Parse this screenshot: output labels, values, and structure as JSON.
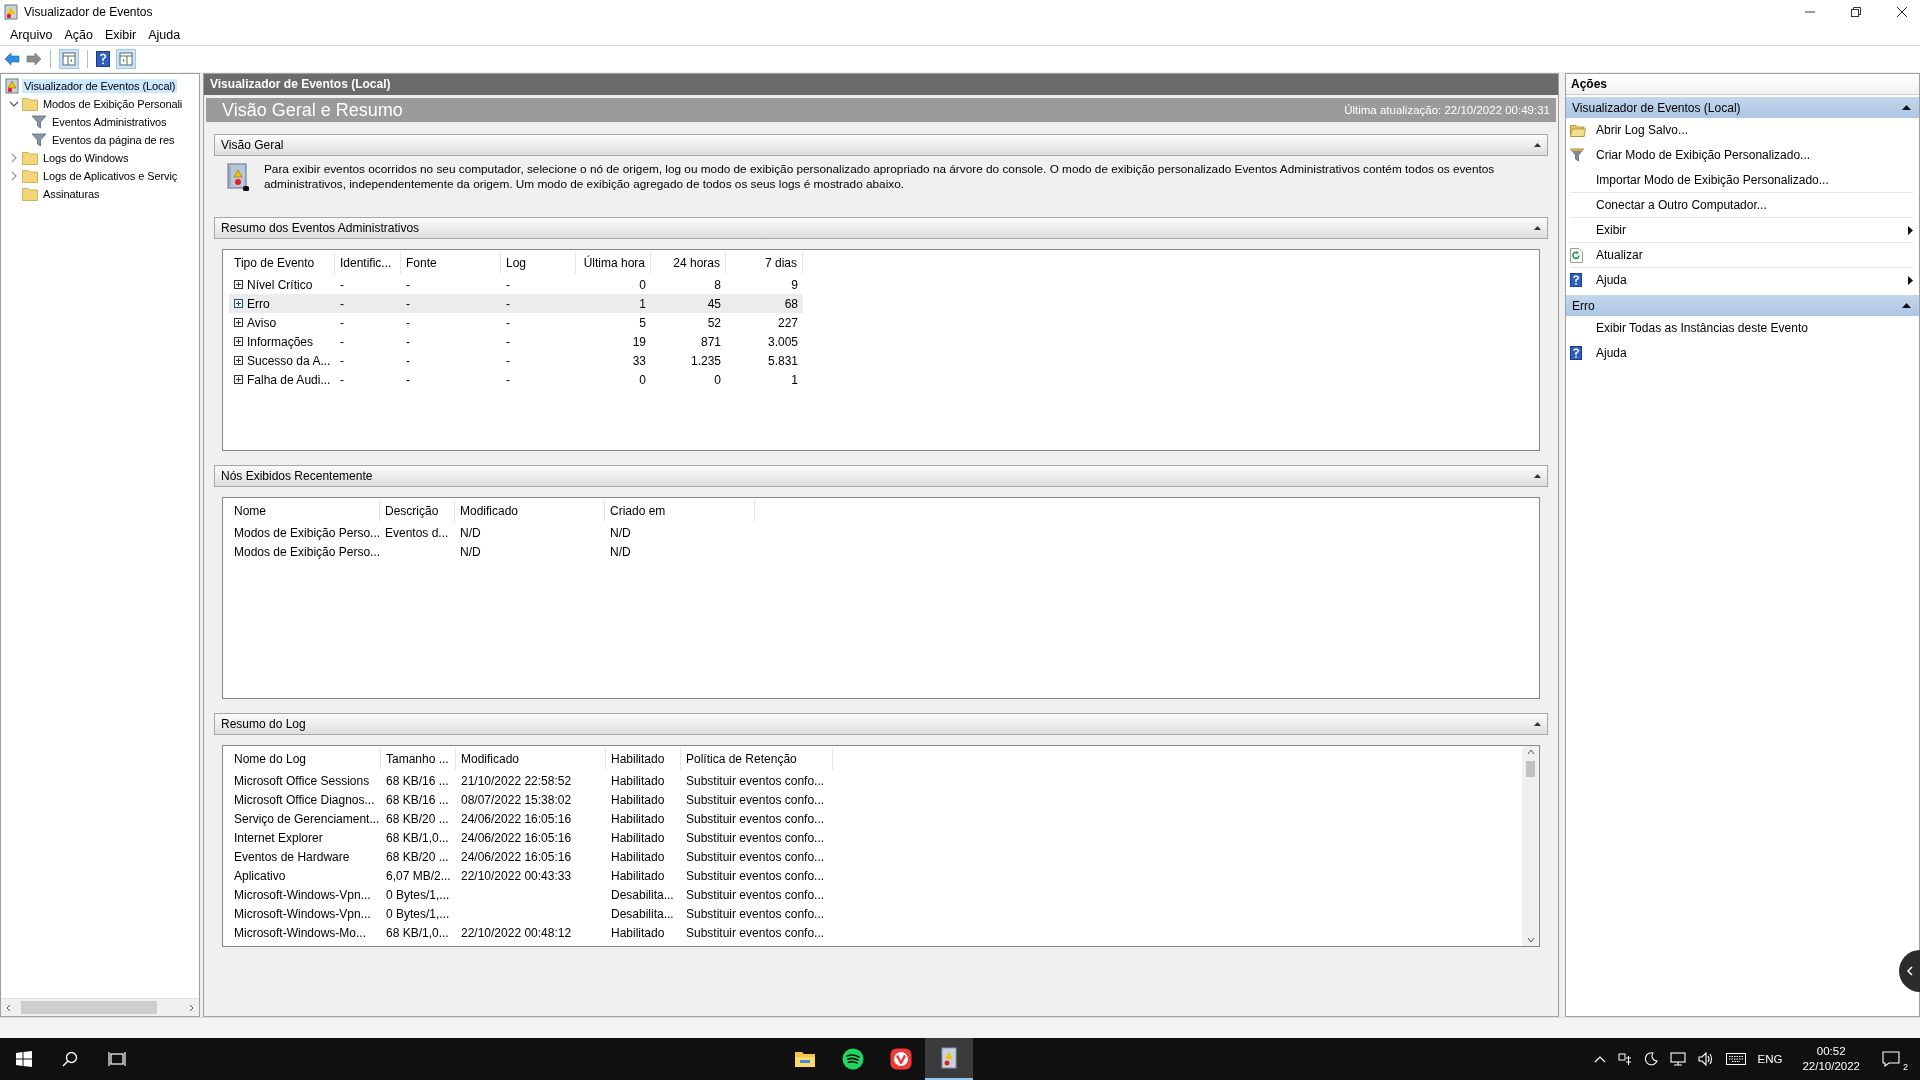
{
  "window": {
    "title": "Visualizador de Eventos"
  },
  "menu": [
    "Arquivo",
    "Ação",
    "Exibir",
    "Ajuda"
  ],
  "tree": [
    {
      "label": "Visualizador de Eventos (Local)",
      "selected": true,
      "children": [
        {
          "label": "Modos de Exibição Personali",
          "selected": false,
          "expanded": true,
          "children": [
            {
              "label": "Eventos Administrativos",
              "selected": false
            },
            {
              "label": "Eventos da página de res",
              "selected": false
            }
          ]
        },
        {
          "label": "Logs do Windows",
          "selected": false,
          "expanded": false
        },
        {
          "label": "Logs de Aplicativos e Serviç",
          "selected": false,
          "expanded": false
        },
        {
          "label": "Assinaturas",
          "selected": false
        }
      ]
    }
  ],
  "center": {
    "title": "Visualizador de Eventos (Local)",
    "heading": "Visão Geral e Resumo",
    "last_update": "Última atualização: 22/10/2022 00:49:31",
    "sections": [
      {
        "kind": "text",
        "title": "Visão Geral",
        "expanded": true,
        "text": "Para exibir eventos ocorridos no seu computador, selecione o nó de origem, log ou modo de exibição personalizado apropriado na árvore do console. O modo de exibição personalizado Eventos Administrativos contém todos os eventos administrativos, independentemente da origem. Um modo de exibição agregado de todos os seus logs é mostrado abaixo."
      },
      {
        "kind": "table",
        "title": "Resumo dos Eventos Administrativos",
        "expanded": true,
        "columns": [
          {
            "label": "Tipo de Evento",
            "numeric": false
          },
          {
            "label": "Identific...",
            "numeric": false
          },
          {
            "label": "Fonte",
            "numeric": false
          },
          {
            "label": "Log",
            "numeric": false
          },
          {
            "label": "Última hora",
            "numeric": true
          },
          {
            "label": "24 horas",
            "numeric": true
          },
          {
            "label": "7 dias",
            "numeric": true
          }
        ],
        "rows": [
          {
            "expanded": false,
            "selected": false,
            "cells": [
              "Nível Crítico",
              "-",
              "-",
              "-",
              "0",
              "8",
              "9"
            ]
          },
          {
            "expanded": false,
            "selected": true,
            "cells": [
              "Erro",
              "-",
              "-",
              "-",
              "1",
              "45",
              "68"
            ]
          },
          {
            "expanded": false,
            "selected": false,
            "cells": [
              "Aviso",
              "-",
              "-",
              "-",
              "5",
              "52",
              "227"
            ]
          },
          {
            "expanded": false,
            "selected": false,
            "cells": [
              "Informações",
              "-",
              "-",
              "-",
              "19",
              "871",
              "3.005"
            ]
          },
          {
            "expanded": false,
            "selected": false,
            "cells": [
              "Sucesso da A...",
              "-",
              "-",
              "-",
              "33",
              "1.235",
              "5.831"
            ]
          },
          {
            "expanded": false,
            "selected": false,
            "cells": [
              "Falha de Audi...",
              "-",
              "-",
              "-",
              "0",
              "0",
              "1"
            ]
          }
        ]
      },
      {
        "kind": "table",
        "title": "Nós Exibidos Recentemente",
        "expanded": true,
        "columns": [
          {
            "label": "Nome",
            "numeric": false
          },
          {
            "label": "Descrição",
            "numeric": false
          },
          {
            "label": "Modificado",
            "numeric": false
          },
          {
            "label": "Criado em",
            "numeric": false
          }
        ],
        "rows": [
          {
            "selected": false,
            "cells": [
              "Modos de Exibição Perso...",
              "Eventos d...",
              "N/D",
              "N/D"
            ]
          },
          {
            "selected": false,
            "cells": [
              "Modos de Exibição Perso...",
              "",
              "N/D",
              "N/D"
            ]
          }
        ]
      },
      {
        "kind": "table",
        "title": "Resumo do Log",
        "expanded": true,
        "columns": [
          {
            "label": "Nome do Log",
            "numeric": false
          },
          {
            "label": "Tamanho ...",
            "numeric": false
          },
          {
            "label": "Modificado",
            "numeric": false
          },
          {
            "label": "Habilitado",
            "numeric": false
          },
          {
            "label": "Política de Retenção",
            "numeric": false
          }
        ],
        "rows": [
          {
            "selected": false,
            "cells": [
              "Microsoft Office Sessions",
              "68 KB/16 ...",
              "21/10/2022 22:58:52",
              "Habilitado",
              "Substituir eventos confo..."
            ]
          },
          {
            "selected": false,
            "cells": [
              "Microsoft Office Diagnos...",
              "68 KB/16 ...",
              "08/07/2022 15:38:02",
              "Habilitado",
              "Substituir eventos confo..."
            ]
          },
          {
            "selected": false,
            "cells": [
              "Serviço de Gerenciament...",
              "68 KB/20 ...",
              "24/06/2022 16:05:16",
              "Habilitado",
              "Substituir eventos confo..."
            ]
          },
          {
            "selected": false,
            "cells": [
              "Internet Explorer",
              "68 KB/1,0...",
              "24/06/2022 16:05:16",
              "Habilitado",
              "Substituir eventos confo..."
            ]
          },
          {
            "selected": false,
            "cells": [
              "Eventos de Hardware",
              "68 KB/20 ...",
              "24/06/2022 16:05:16",
              "Habilitado",
              "Substituir eventos confo..."
            ]
          },
          {
            "selected": false,
            "cells": [
              "Aplicativo",
              "6,07 MB/2...",
              "22/10/2022 00:43:33",
              "Habilitado",
              "Substituir eventos confo..."
            ]
          },
          {
            "selected": false,
            "cells": [
              "Microsoft-Windows-Vpn...",
              "0 Bytes/1,...",
              "",
              "Desabilita...",
              "Substituir eventos confo..."
            ]
          },
          {
            "selected": false,
            "cells": [
              "Microsoft-Windows-Vpn...",
              "0 Bytes/1,...",
              "",
              "Desabilita...",
              "Substituir eventos confo..."
            ]
          },
          {
            "selected": false,
            "cells": [
              "Microsoft-Windows-Mo...",
              "68 KB/1,0...",
              "22/10/2022 00:48:12",
              "Habilitado",
              "Substituir eventos confo..."
            ]
          }
        ]
      }
    ]
  },
  "actions": {
    "title": "Ações",
    "groups": [
      {
        "title": "Visualizador de Eventos (Local)",
        "expanded": true,
        "items": [
          {
            "label": "Abrir Log Salvo...",
            "submenu": false
          },
          {
            "label": "Criar Modo de Exibição Personalizado...",
            "submenu": false
          },
          {
            "label": "Importar Modo de Exibição Personalizado...",
            "submenu": false
          },
          {
            "label": "Conectar a Outro Computador...",
            "submenu": false
          },
          {
            "label": "Exibir",
            "submenu": true
          },
          {
            "label": "Atualizar",
            "submenu": false
          },
          {
            "label": "Ajuda",
            "submenu": true
          }
        ]
      },
      {
        "title": "Erro",
        "expanded": true,
        "items": [
          {
            "label": "Exibir Todas as Instâncias deste Evento",
            "submenu": false
          },
          {
            "label": "Ajuda",
            "submenu": false
          }
        ]
      }
    ]
  },
  "taskbar": {
    "apps": [
      {
        "selected": false
      },
      {
        "selected": false
      },
      {
        "selected": false
      },
      {
        "selected": true
      }
    ],
    "language": "ENG",
    "time": "00:52",
    "date": "22/10/2022",
    "notifications": "2"
  }
}
